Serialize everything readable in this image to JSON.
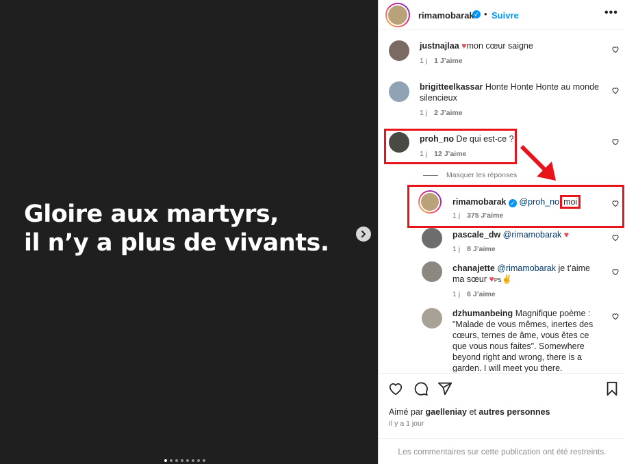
{
  "post": {
    "media_lines": [
      "Gloire aux martyrs,",
      "il n’y a plus de vivants."
    ],
    "carousel_dot_count": 8,
    "carousel_active_index": 0
  },
  "header": {
    "username": "rimamobarak",
    "separator": "•",
    "follow_label": "Suivre",
    "more_label": "•••"
  },
  "comments": [
    {
      "username": "justnajlaa",
      "text": "mon cœur saigne",
      "age": "1 j",
      "likes": "1 J’aime"
    },
    {
      "username": "brigitteelkassar",
      "text": "Honte Honte Honte au monde silencieux",
      "age": "1 j",
      "likes": "2 J’aime"
    },
    {
      "username": "proh_no",
      "text": "De qui est-ce ?",
      "age": "1 j",
      "likes": "12 J’aime"
    }
  ],
  "hide_replies_label": "Masquer les réponses",
  "replies": [
    {
      "username": "rimamobarak",
      "mention": "@proh_no",
      "text": "moi",
      "age": "1 j",
      "likes": "375 J’aime"
    },
    {
      "username": "pascale_dw",
      "mention": "@rimamobarak",
      "text": "",
      "age": "1 j",
      "likes": "8 J’aime"
    },
    {
      "username": "chanajette",
      "mention": "@rimamobarak",
      "text": "je t’aime ma sœur",
      "suffix": "PS",
      "age": "1 j",
      "likes": "6 J’aime"
    },
    {
      "username": "dzhumanbeing",
      "mention": "",
      "text": "Magnifique poème : \"Malade de vous mêmes, inertes des cœurs, ternes de âme, vous êtes ce que vous nous faites\". Somewhere beyond right and wrong, there is a garden. I will meet you there.",
      "age": "",
      "likes": ""
    }
  ],
  "footer": {
    "liked_by_prefix": "Aimé par",
    "liked_by_user": "gaelleniay",
    "liked_by_and": "et",
    "liked_by_others": "autres personnes",
    "date": "Il y a 1 jour",
    "restricted": "Les commentaires sur cette publication ont été restreints."
  },
  "colors": {
    "accent_blue": "#0095f6",
    "annotation_red": "#e8141a",
    "media_bg": "#1f1f1f"
  }
}
